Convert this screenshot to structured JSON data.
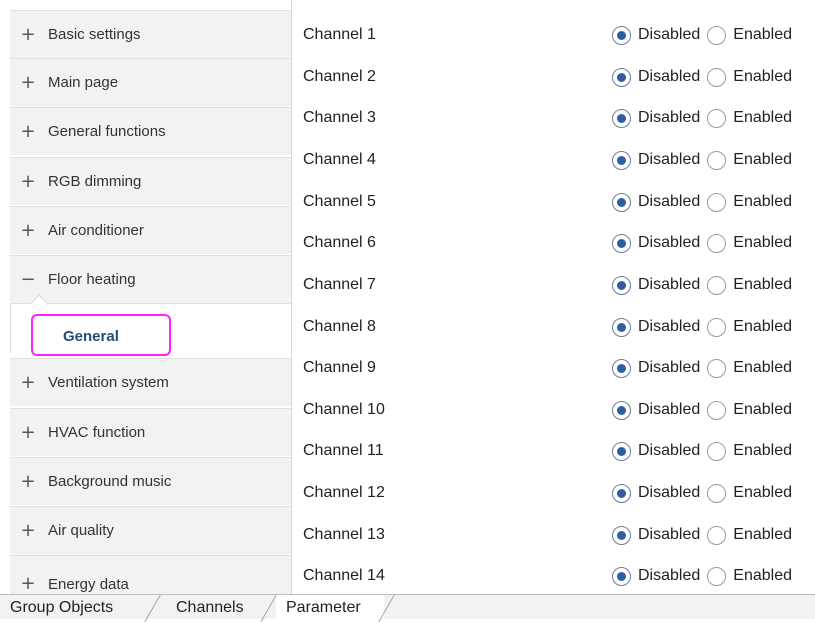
{
  "sidebar": {
    "items": [
      {
        "icon": "plus-icon",
        "symbol": "+",
        "label": "Basic settings"
      },
      {
        "icon": "plus-icon",
        "symbol": "+",
        "label": "Main page"
      },
      {
        "icon": "plus-icon",
        "symbol": "+",
        "label": "General functions"
      },
      {
        "icon": "plus-icon",
        "symbol": "+",
        "label": "RGB dimming"
      },
      {
        "icon": "plus-icon",
        "symbol": "+",
        "label": "Air conditioner"
      },
      {
        "icon": "minus-icon",
        "symbol": "−",
        "label": "Floor heating"
      },
      {
        "icon": "plus-icon",
        "symbol": "+",
        "label": "Ventilation system"
      },
      {
        "icon": "plus-icon",
        "symbol": "+",
        "label": "HVAC function"
      },
      {
        "icon": "plus-icon",
        "symbol": "+",
        "label": "Background music"
      },
      {
        "icon": "plus-icon",
        "symbol": "+",
        "label": "Air quality"
      },
      {
        "icon": "plus-icon",
        "symbol": "+",
        "label": "Energy data"
      }
    ],
    "subitem": {
      "label": "General",
      "parent": "Floor heating",
      "highlight_color": "#ff22ff"
    }
  },
  "channels": {
    "option_disabled": "Disabled",
    "option_enabled": "Enabled",
    "rows": [
      {
        "name": "Channel 1",
        "selected": "Disabled"
      },
      {
        "name": "Channel 2",
        "selected": "Disabled"
      },
      {
        "name": "Channel 3",
        "selected": "Disabled"
      },
      {
        "name": "Channel 4",
        "selected": "Disabled"
      },
      {
        "name": "Channel 5",
        "selected": "Disabled"
      },
      {
        "name": "Channel 6",
        "selected": "Disabled"
      },
      {
        "name": "Channel 7",
        "selected": "Disabled"
      },
      {
        "name": "Channel 8",
        "selected": "Disabled"
      },
      {
        "name": "Channel 9",
        "selected": "Disabled"
      },
      {
        "name": "Channel 10",
        "selected": "Disabled"
      },
      {
        "name": "Channel 11",
        "selected": "Disabled"
      },
      {
        "name": "Channel 12",
        "selected": "Disabled"
      },
      {
        "name": "Channel 13",
        "selected": "Disabled"
      },
      {
        "name": "Channel 14",
        "selected": "Disabled"
      }
    ]
  },
  "tabs": [
    {
      "label": "Group Objects",
      "active": false
    },
    {
      "label": "Channels",
      "active": false
    },
    {
      "label": "Parameter",
      "active": true
    }
  ],
  "colors": {
    "accent": "#2f5fa0",
    "sub_label": "#1f4e79"
  }
}
